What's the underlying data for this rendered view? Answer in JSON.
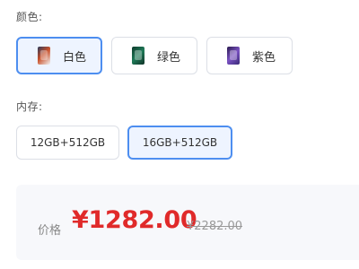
{
  "color_section": {
    "label": "颜色:",
    "options": [
      {
        "label": "白色",
        "thumb_icon": "phone-thumbnail-white-icon",
        "selected": true
      },
      {
        "label": "绿色",
        "thumb_icon": "phone-thumbnail-green-icon",
        "selected": false
      },
      {
        "label": "紫色",
        "thumb_icon": "phone-thumbnail-purple-icon",
        "selected": false
      }
    ]
  },
  "memory_section": {
    "label": "内存:",
    "options": [
      {
        "label": "12GB+512GB",
        "selected": false
      },
      {
        "label": "16GB+512GB",
        "selected": true
      }
    ]
  },
  "price": {
    "label": "价格",
    "current": "¥1282.00",
    "original": "¥2282.00"
  },
  "colors": {
    "accent": "#4d8ef0",
    "selected_bg": "#eef4ff",
    "price_red": "#e02a2a"
  }
}
